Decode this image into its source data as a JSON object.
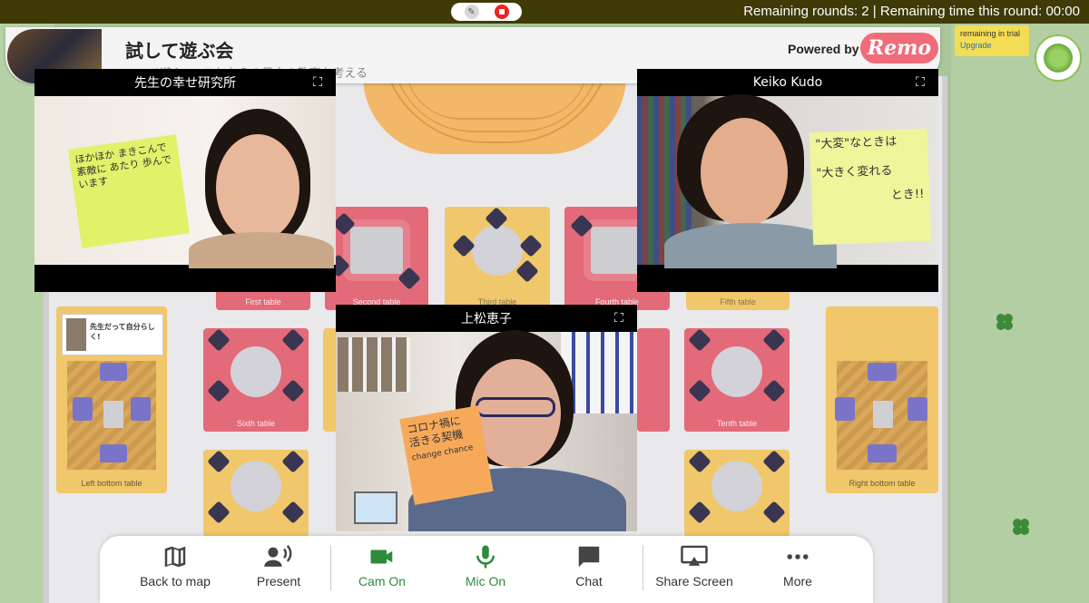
{
  "topbar": {
    "edit_icon": "pencil-icon",
    "stop_icon": "stop-record-icon",
    "status": "Remaining rounds: 2 | Remaining time this round: 00:00"
  },
  "header": {
    "title": "試して遊ぶ会",
    "subtitle": "〜 で遊ぶ 〜 これからの日本の教育を考える",
    "powered_by": "Powered by",
    "brand": "Remo",
    "trial_text": "remaining in trial",
    "upgrade": "Upgrade"
  },
  "tables": {
    "first": "First table",
    "second": "Second table",
    "third": "Third table",
    "fourth": "Fourth table",
    "fifth": "Fifth table",
    "sixth": "Sixth table",
    "tenth": "Tenth table",
    "left_bottom": "Left bottom table",
    "right_bottom": "Right bottom table"
  },
  "poster": {
    "text": "先生だって自分らしく!"
  },
  "videos": [
    {
      "name": "先生の幸せ研究所",
      "note": "ほかほか まきこんで 素敵に あたり 歩んでいます"
    },
    {
      "name": "Keiko Kudo",
      "note_line1": "\"大変\"なときは",
      "note_line2": "\"大きく変れる",
      "note_line3": "とき!!"
    },
    {
      "name": "上松恵子",
      "note_line1": "コロナ禍に",
      "note_line2": "活きる契機",
      "note_line3": "change chance"
    }
  ],
  "controls": [
    {
      "label": "Back to map",
      "icon": "map-icon"
    },
    {
      "label": "Present",
      "icon": "present-icon"
    },
    {
      "label": "Cam On",
      "icon": "camera-icon"
    },
    {
      "label": "Mic On",
      "icon": "mic-icon"
    },
    {
      "label": "Chat",
      "icon": "chat-icon"
    },
    {
      "label": "Share Screen",
      "icon": "share-screen-icon"
    },
    {
      "label": "More",
      "icon": "more-icon"
    }
  ],
  "colors": {
    "topbar": "#3f3a06",
    "accent_green": "#2e8b3a",
    "brand_pink": "#f06c7a",
    "table_red": "#e36a78",
    "table_yellow": "#f0c76a"
  }
}
